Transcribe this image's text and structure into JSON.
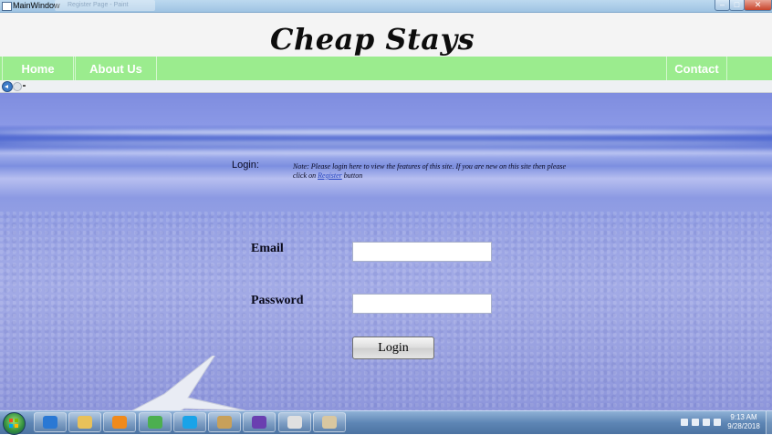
{
  "window": {
    "title": "MainWindow",
    "background_tab": "Register Page - Paint",
    "controls": {
      "minimize": "–",
      "maximize": "□",
      "close": "✕"
    }
  },
  "header": {
    "brand": "Cheap Stays"
  },
  "nav": {
    "home": "Home",
    "about": "About Us",
    "contact": "Contact Us",
    "color": "#9bec8e"
  },
  "login": {
    "heading": "Login:",
    "note_before": "Note: Please login here to view the features of this site. If you are new on this site then please click on",
    "note_link": "Register",
    "note_after": "button",
    "email_label": "Email",
    "email_value": "",
    "password_label": "Password",
    "password_value": "",
    "button": "Login"
  },
  "taskbar": {
    "pinned": [
      {
        "icon": "internet-explorer-icon",
        "color": "#2a78d4"
      },
      {
        "icon": "file-explorer-icon",
        "color": "#e8c15a"
      },
      {
        "icon": "media-player-icon",
        "color": "#f08a1c"
      },
      {
        "icon": "chrome-icon",
        "color": "#4caf50"
      },
      {
        "icon": "skype-icon",
        "color": "#1aa3e8"
      },
      {
        "icon": "network-tool-icon",
        "color": "#c7a05a"
      },
      {
        "icon": "visual-studio-icon",
        "color": "#6a3fb0"
      },
      {
        "icon": "calculator-icon",
        "color": "#e0e0e0"
      },
      {
        "icon": "paint-icon",
        "color": "#d9c7a0"
      }
    ],
    "time": "9:13 AM",
    "date": "9/28/2018"
  }
}
